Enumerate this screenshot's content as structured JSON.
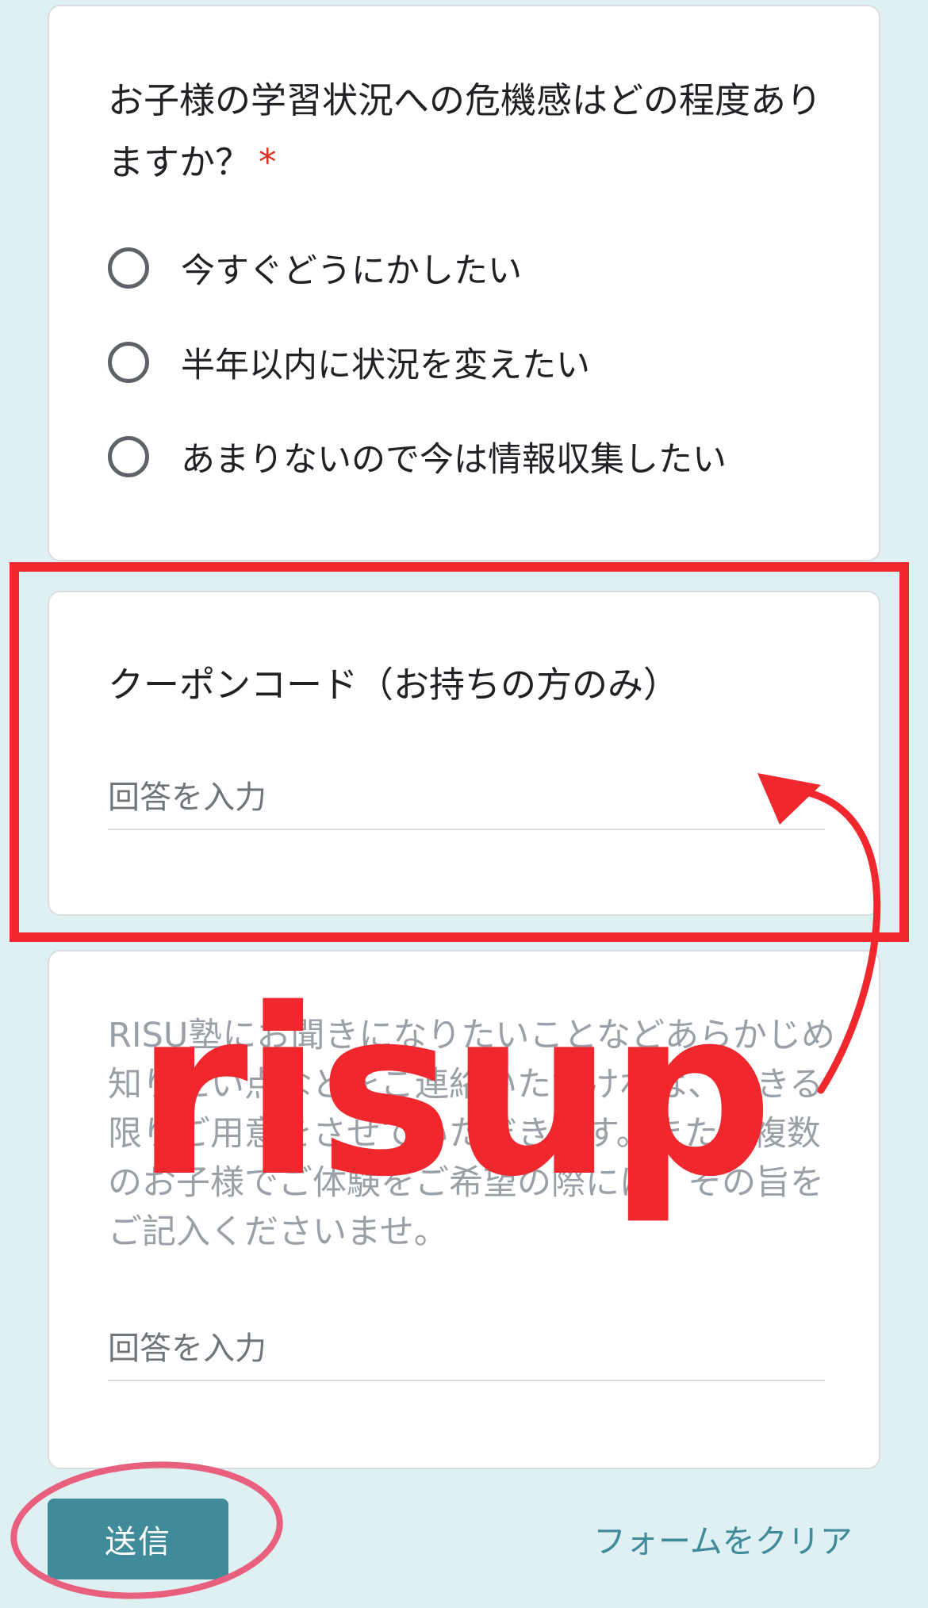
{
  "question1": {
    "title": "お子様の学習状況への危機感はどの程度ありますか？",
    "required_mark": "*",
    "options": [
      "今すぐどうにかしたい",
      "半年以内に状況を変えたい",
      "あまりないので今は情報収集したい"
    ]
  },
  "coupon": {
    "title": "クーポンコード（お持ちの方のみ）",
    "placeholder": "回答を入力"
  },
  "notes": {
    "description": "RISU塾にお聞きになりたいことなどあらかじめ知りたい点などをご連絡いただければ、できる限りご用意をさせていただきます。また、複数のお子様でご体験をご希望の際には、その旨をご記入くださいませ。",
    "placeholder": "回答を入力"
  },
  "footer": {
    "submit_label": "送信",
    "clear_label": "フォームをクリア"
  },
  "watermark": {
    "text": "risup"
  },
  "colors": {
    "page_bg": "#dff0f2",
    "accent": "#3f8b9a",
    "required": "#d93025",
    "annotation_red": "#f0282e",
    "annotation_pink": "#e8607e"
  }
}
